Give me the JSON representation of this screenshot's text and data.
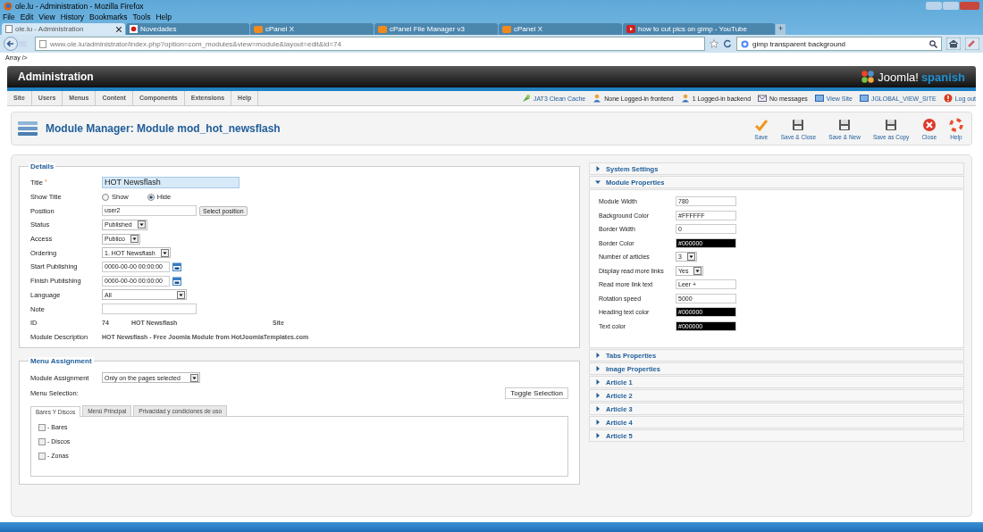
{
  "browser": {
    "title": "ole.lu - Administration - Mozilla Firefox",
    "menu": [
      "File",
      "Edit",
      "View",
      "History",
      "Bookmarks",
      "Tools",
      "Help"
    ],
    "tabs": [
      {
        "label": "ole.lu - Administration",
        "selected": true,
        "kind": "page"
      },
      {
        "label": "Novedades",
        "selected": false,
        "kind": "red"
      },
      {
        "label": "cPanel X",
        "selected": false,
        "kind": "cpanel"
      },
      {
        "label": "cPanel File Manager v3",
        "selected": false,
        "kind": "cpanel"
      },
      {
        "label": "cPanel X",
        "selected": false,
        "kind": "cpanel"
      },
      {
        "label": "how to cut pics on gimp - YouTube",
        "selected": false,
        "kind": "youtube"
      }
    ],
    "url": "www.ole.lu/administrator/index.php?option=com_modules&view=module&layout=edit&id=74",
    "search": "gimp transparent background",
    "new_tab": "+"
  },
  "pre_text": "Array />",
  "header": {
    "title": "Administration",
    "logo": "Joomla!",
    "logo_suffix": "spanish"
  },
  "menu": [
    "Site",
    "Users",
    "Menus",
    "Content",
    "Components",
    "Extensions",
    "Help"
  ],
  "status_links": [
    {
      "label": "JAT3 Clean Cache",
      "kind": "cache"
    },
    {
      "label": "None Logged-in frontend",
      "kind": "user"
    },
    {
      "label": "1 Logged-in backend",
      "kind": "user"
    },
    {
      "label": "No messages",
      "kind": "message"
    },
    {
      "label": "View Site",
      "kind": "screen"
    },
    {
      "label": "JGLOBAL_VIEW_SITE",
      "kind": "screen"
    },
    {
      "label": "Log out",
      "kind": "logout"
    }
  ],
  "toolbar": {
    "title": "Module Manager: Module mod_hot_newsflash",
    "buttons": [
      {
        "label": "Save",
        "kind": "check"
      },
      {
        "label": "Save & Close",
        "kind": "save"
      },
      {
        "label": "Save & New",
        "kind": "save"
      },
      {
        "label": "Save as Copy",
        "kind": "save"
      },
      {
        "label": "Close",
        "kind": "close"
      },
      {
        "label": "Help",
        "kind": "help"
      }
    ]
  },
  "details": {
    "legend": "Details",
    "fields": [
      {
        "label": "Title",
        "required_mark": "*",
        "kind": "title",
        "value": "HOT Newsflash"
      },
      {
        "label": "Show Title",
        "kind": "radio",
        "options": [
          {
            "label": "Show",
            "selected": false
          },
          {
            "label": "Hide",
            "selected": true
          }
        ]
      },
      {
        "label": "Position",
        "kind": "text",
        "value": "user2",
        "button": "Select position"
      },
      {
        "label": "Status",
        "kind": "select",
        "value": "Published"
      },
      {
        "label": "Access",
        "kind": "select",
        "value": "Publico"
      },
      {
        "label": "Ordering",
        "kind": "select",
        "value": "1. HOT Newsflash"
      },
      {
        "label": "Start Publishing",
        "kind": "date",
        "value": "0000-00-00 00:00:00"
      },
      {
        "label": "Finish Publishing",
        "kind": "date",
        "value": "0000-00-00 00:00:00"
      },
      {
        "label": "Language",
        "kind": "wideselect",
        "value": "All"
      },
      {
        "label": "Note",
        "kind": "text"
      },
      {
        "label": "ID",
        "kind": "info",
        "values": [
          "74",
          "HOT Newsflash",
          "Site"
        ]
      },
      {
        "label": "Module Description",
        "kind": "info",
        "values": [
          "HOT Newsflash - Free Joomla Module from HotJoomlaTemplates.com"
        ]
      }
    ]
  },
  "menu_assignment": {
    "legend": "Menu Assignment",
    "assignment_label": "Module Assignment",
    "assignment_value": "Only on the pages selected",
    "selection_label": "Menu Selection:",
    "toggle_button": "Toggle Selection",
    "tabs": [
      {
        "label": "Bares Y Discos",
        "selected": true
      },
      {
        "label": "Menú Principal",
        "selected": false
      },
      {
        "label": "Privacidad y condiciones de uso",
        "selected": false
      }
    ],
    "items": [
      {
        "label": "- Bares",
        "checked": false
      },
      {
        "label": "- Discos",
        "checked": false
      },
      {
        "label": "- Zonas",
        "checked": false
      }
    ]
  },
  "sections": [
    {
      "title": "System Settings",
      "expanded": false
    },
    {
      "title": "Module Properties",
      "expanded": true,
      "fields": [
        {
          "label": "Module Width",
          "kind": "text",
          "value": "780"
        },
        {
          "label": "Background Color",
          "kind": "text",
          "value": "#FFFFFF"
        },
        {
          "label": "Border Width",
          "kind": "text",
          "value": "0"
        },
        {
          "label": "Border Color",
          "kind": "color",
          "value": "#000000",
          "color": "#000000"
        },
        {
          "label": "Number of articles",
          "kind": "select",
          "value": "3"
        },
        {
          "label": "Display read more links",
          "kind": "select",
          "value": "Yes"
        },
        {
          "label": "Read more link text",
          "kind": "text",
          "value": "Leer +"
        },
        {
          "label": "Rotation speed",
          "kind": "text",
          "value": "5000"
        },
        {
          "label": "Heading text color",
          "kind": "color",
          "value": "#000000",
          "color": "#000000"
        },
        {
          "label": "Text color",
          "kind": "color",
          "value": "#000000",
          "color": "#000000"
        }
      ]
    },
    {
      "title": "Tabs Properties",
      "expanded": false
    },
    {
      "title": "Image Properties",
      "expanded": false
    },
    {
      "title": "Article 1",
      "expanded": false
    },
    {
      "title": "Article 2",
      "expanded": false
    },
    {
      "title": "Article 3",
      "expanded": false
    },
    {
      "title": "Article 4",
      "expanded": false
    },
    {
      "title": "Article 5",
      "expanded": false
    }
  ]
}
